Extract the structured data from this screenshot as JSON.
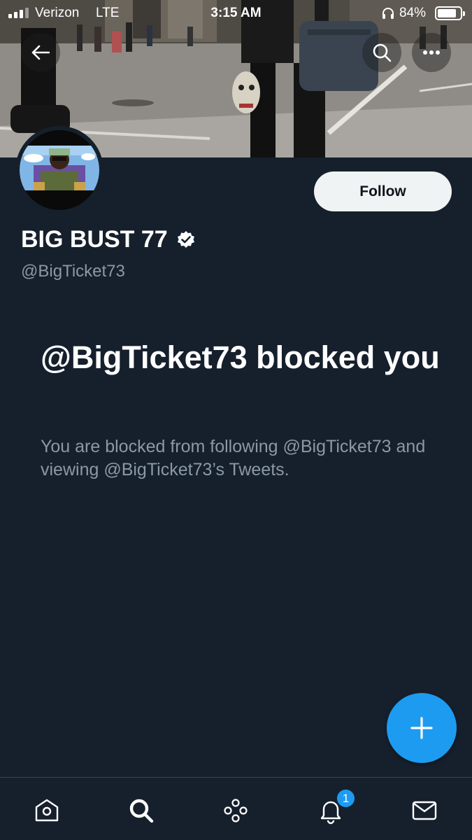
{
  "status_bar": {
    "carrier": "Verizon",
    "network": "LTE",
    "time": "3:15 AM",
    "battery": "84%",
    "battery_level": 0.84
  },
  "profile": {
    "display_name": "BIG BUST 77",
    "handle": "@BigTicket73",
    "verified": true,
    "follow_label": "Follow"
  },
  "blocked": {
    "title": "@BigTicket73 blocked you",
    "description": "You are blocked from following @BigTicket73 and viewing @BigTicket73’s Tweets."
  },
  "nav": {
    "items": [
      "home-icon",
      "search-icon",
      "spaces-icon",
      "notifications-icon",
      "messages-icon"
    ],
    "notification_count": "1"
  },
  "colors": {
    "background": "#16202c",
    "accent": "#1d9bf0",
    "secondary_text": "#8b98a5",
    "follow_button": "#eff3f4"
  }
}
